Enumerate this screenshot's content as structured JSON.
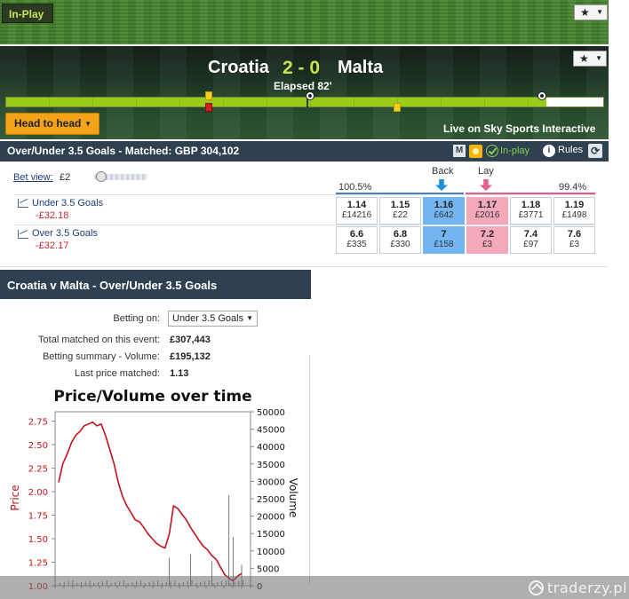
{
  "inplay_tag": "In-Play",
  "match": {
    "home": "Croatia",
    "score": "2 - 0",
    "away": "Malta",
    "elapsed": "Elapsed 82'",
    "timeline_progress": 0.905,
    "head_to_head": "Head to head",
    "live_on": "Live on Sky Sports Interactive"
  },
  "market_bar": {
    "title": "Over/Under 3.5 Goals - Matched: GBP 304,102",
    "m_badge": "M",
    "inplay_label": "In-play",
    "info_badge": "i",
    "rules_label": "Rules"
  },
  "market": {
    "bet_view_label": "Bet view:",
    "bet_view_value": "£2",
    "back_label": "Back",
    "lay_label": "Lay",
    "back_pct": "100.5%",
    "lay_pct": "99.4%",
    "runners": [
      {
        "name": "Under 3.5 Goals",
        "pl": "-£32.18",
        "prices": [
          {
            "p": "1.14",
            "v": "£14216"
          },
          {
            "p": "1.15",
            "v": "£22"
          },
          {
            "p": "1.16",
            "v": "£642"
          },
          {
            "p": "1.17",
            "v": "£2016"
          },
          {
            "p": "1.18",
            "v": "£3771"
          },
          {
            "p": "1.19",
            "v": "£1498"
          }
        ]
      },
      {
        "name": "Over 3.5 Goals",
        "pl": "-£32.17",
        "prices": [
          {
            "p": "6.6",
            "v": "£335"
          },
          {
            "p": "6.8",
            "v": "£330"
          },
          {
            "p": "7",
            "v": "£158"
          },
          {
            "p": "7.2",
            "v": "£3"
          },
          {
            "p": "7.4",
            "v": "£97"
          },
          {
            "p": "7.6",
            "v": "£3"
          }
        ]
      }
    ]
  },
  "panel": {
    "title": "Croatia v Malta - Over/Under 3.5 Goals",
    "betting_on_label": "Betting on:",
    "betting_on_value": "Under 3.5 Goals",
    "total_matched_label": "Total matched on this event:",
    "total_matched_value": "£307,443",
    "betting_summary_label": "Betting summary - Volume:",
    "betting_summary_value": "£195,132",
    "last_price_label": "Last price matched:",
    "last_price_value": "1.13"
  },
  "chart_data": {
    "type": "line",
    "title": "Price/Volume over time",
    "ylabel_left": "Price",
    "ylabel_right": "Volume",
    "left_ticks": [
      "1.00",
      "1.25",
      "1.50",
      "1.75",
      "2.00",
      "2.25",
      "2.50",
      "2.75"
    ],
    "right_ticks": [
      "0",
      "5000",
      "10000",
      "15000",
      "20000",
      "25000",
      "30000",
      "35000",
      "40000",
      "45000",
      "50000"
    ],
    "ylim_price": [
      1.0,
      2.85
    ],
    "ylim_volume": [
      0,
      50000
    ],
    "price_series": [
      2.1,
      2.3,
      2.4,
      2.52,
      2.6,
      2.64,
      2.7,
      2.72,
      2.74,
      2.7,
      2.72,
      2.6,
      2.45,
      2.3,
      2.1,
      1.95,
      1.85,
      1.78,
      1.7,
      1.68,
      1.62,
      1.55,
      1.5,
      1.45,
      1.42,
      1.4,
      1.55,
      1.85,
      1.82,
      1.76,
      1.7,
      1.62,
      1.55,
      1.48,
      1.42,
      1.38,
      1.32,
      1.28,
      1.2,
      1.12,
      1.08,
      1.05,
      1.1,
      1.13
    ],
    "volume_spikes": [
      {
        "i": 26,
        "v": 8000
      },
      {
        "i": 31,
        "v": 9000
      },
      {
        "i": 36,
        "v": 7000
      },
      {
        "i": 40,
        "v": 26000
      },
      {
        "i": 41,
        "v": 14000
      },
      {
        "i": 43,
        "v": 6000
      }
    ]
  },
  "watermark": "traderzy.pl",
  "colors": {
    "price_line": "#c0141a",
    "volume_bars": "#7a7a7a",
    "best_back": "#73b5f0",
    "best_lay": "#f4a9bb"
  }
}
